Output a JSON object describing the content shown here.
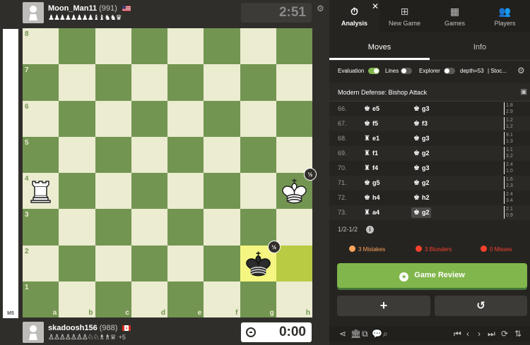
{
  "players": {
    "top": {
      "name": "Moon_Man11",
      "rating": "(991)",
      "captured": "♟♟♟♟♟♟♟♟♝♝♞♞♛",
      "plus": ""
    },
    "bottom": {
      "name": "skadoosh156",
      "rating": "(988)",
      "captured": "♙♙♙♙♙♙♙♘♘♗♗♕",
      "plus": "+5"
    }
  },
  "clocks": {
    "top": "2:51",
    "bottom": "0:00"
  },
  "eval_bar": {
    "label": "M5",
    "white_fraction": 1.0
  },
  "board": {
    "files": [
      "a",
      "b",
      "c",
      "d",
      "e",
      "f",
      "g",
      "h"
    ],
    "ranks": [
      "8",
      "7",
      "6",
      "5",
      "4",
      "3",
      "2",
      "1"
    ],
    "pieces": [
      {
        "square": "a4",
        "type": "white-rook"
      },
      {
        "square": "h4",
        "type": "white-king",
        "badge": "½"
      },
      {
        "square": "g2",
        "type": "black-king",
        "badge": "½"
      }
    ],
    "highlighted": [
      "g2",
      "h2"
    ]
  },
  "nav": {
    "tabs": [
      {
        "label": "Analysis",
        "icon": "stopwatch-icon",
        "glyph": "⏱"
      },
      {
        "label": "New Game",
        "icon": "plus-square-icon",
        "glyph": "⊞"
      },
      {
        "label": "Games",
        "icon": "checkerboard-icon",
        "glyph": "▦"
      },
      {
        "label": "Players",
        "icon": "players-icon",
        "glyph": "👥"
      }
    ],
    "close": "✕"
  },
  "subtabs": [
    "Moves",
    "Info"
  ],
  "eval_settings": {
    "evaluation_label": "Evaluation",
    "lines_label": "Lines",
    "explorer_label": "Explorer",
    "depth_label": "depth=53",
    "engine_label": "| Stoc..."
  },
  "opening": "Modern Defense: Bishop Attack",
  "moves": [
    {
      "num": "66.",
      "white_piece": "♚",
      "white": "e5",
      "black_piece": "♚",
      "black": "g3",
      "t1": "1.8",
      "t2": "2.9"
    },
    {
      "num": "67.",
      "white_piece": "♚",
      "white": "f5",
      "black_piece": "♚",
      "black": "f3",
      "t1": "1.2",
      "t2": "1.2"
    },
    {
      "num": "68.",
      "white_piece": "♜",
      "white": "e1",
      "black_piece": "♚",
      "black": "g3",
      "t1": "9.1",
      "t2": "1.3"
    },
    {
      "num": "69.",
      "white_piece": "♜",
      "white": "f1",
      "black_piece": "♚",
      "black": "g2",
      "t1": "1.1",
      "t2": "3.2"
    },
    {
      "num": "70.",
      "white_piece": "♜",
      "white": "f4",
      "black_piece": "♚",
      "black": "g3",
      "t1": "2.4",
      "t2": "1.0"
    },
    {
      "num": "71.",
      "white_piece": "♚",
      "white": "g5",
      "black_piece": "♚",
      "black": "g2",
      "t1": "1.6",
      "t2": "2.3"
    },
    {
      "num": "72.",
      "white_piece": "♚",
      "white": "h4",
      "black_piece": "♚",
      "black": "h2",
      "t1": "2.4",
      "t2": "3.4"
    },
    {
      "num": "73.",
      "white_piece": "♜",
      "white": "a4",
      "black_piece": "♚",
      "black": "g2",
      "t1": "2.1",
      "t2": "0.9"
    }
  ],
  "result": "1/2-1/2",
  "stats": {
    "mistakes": "3 Mistakes",
    "blunders": "3 Blunders",
    "misses": "0 Misses"
  },
  "review_button": "Game Review",
  "colors": {
    "accent_green": "#81b64c",
    "board_light": "#ebecd0",
    "board_dark": "#739552",
    "mistake": "#ffa459",
    "blunder": "#fa412d"
  }
}
